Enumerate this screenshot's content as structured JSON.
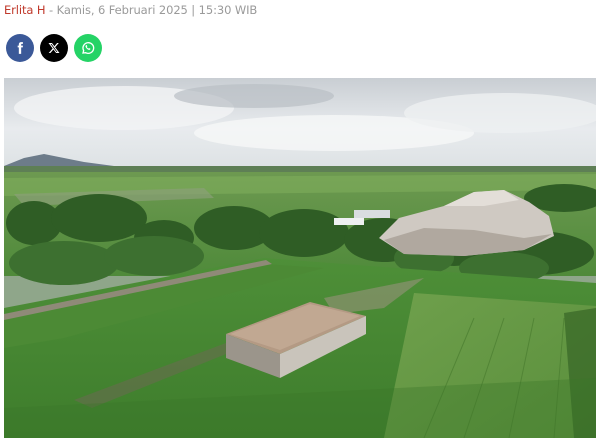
{
  "article": {
    "author": "Erlita H",
    "separator": " - ",
    "published": "Kamis, 6 Februari 2025 | 15:30 WIB"
  },
  "share": {
    "buttons": [
      {
        "icon": "facebook-icon",
        "color": "#3b5998"
      },
      {
        "icon": "x-twitter-icon",
        "color": "#000000"
      },
      {
        "icon": "whatsapp-icon",
        "color": "#25d366"
      }
    ]
  },
  "colors": {
    "author": "#c0392b",
    "meta": "#9a9a9a"
  }
}
